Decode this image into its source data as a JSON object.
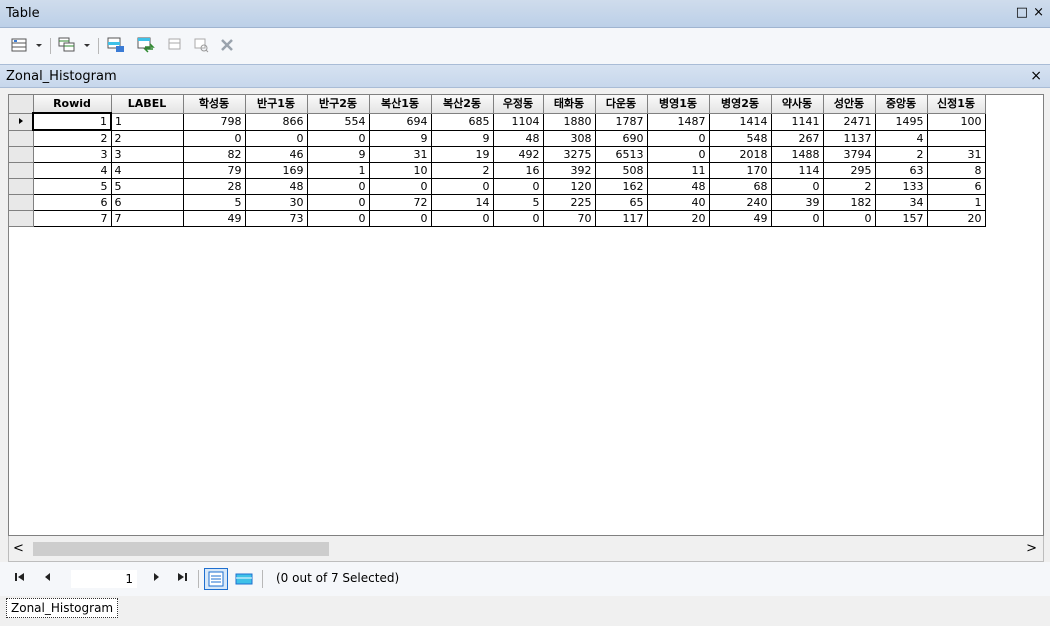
{
  "window": {
    "title": "Table",
    "restore_glyph": "□",
    "close_glyph": "×"
  },
  "toolbar": {
    "icons": [
      "table-options-icon",
      "dropdown-arrow-icon",
      "related-tables-icon",
      "dropdown-arrow-icon",
      "select-by-attributes-icon",
      "switch-selection-icon",
      "clear-selection-icon",
      "zoom-to-selected-icon",
      "delete-selected-icon"
    ]
  },
  "tab": {
    "title": "Zonal_Histogram",
    "close_glyph": "×"
  },
  "table": {
    "columns": [
      "Rowid",
      "LABEL",
      "학성동",
      "반구1동",
      "반구2동",
      "복산1동",
      "복산2동",
      "우정동",
      "태화동",
      "다운동",
      "병영1동",
      "병영2동",
      "약사동",
      "성안동",
      "중앙동",
      "신정1동"
    ],
    "column_widths": [
      78,
      72,
      62,
      62,
      62,
      62,
      62,
      50,
      52,
      52,
      62,
      62,
      52,
      52,
      52,
      58
    ],
    "rows": [
      [
        "1",
        "1",
        "798",
        "866",
        "554",
        "694",
        "685",
        "1104",
        "1880",
        "1787",
        "1487",
        "1414",
        "1141",
        "2471",
        "1495",
        "100"
      ],
      [
        "2",
        "2",
        "0",
        "0",
        "0",
        "9",
        "9",
        "48",
        "308",
        "690",
        "0",
        "548",
        "267",
        "1137",
        "4",
        ""
      ],
      [
        "3",
        "3",
        "82",
        "46",
        "9",
        "31",
        "19",
        "492",
        "3275",
        "6513",
        "0",
        "2018",
        "1488",
        "3794",
        "2",
        "31"
      ],
      [
        "4",
        "4",
        "79",
        "169",
        "1",
        "10",
        "2",
        "16",
        "392",
        "508",
        "11",
        "170",
        "114",
        "295",
        "63",
        "8"
      ],
      [
        "5",
        "5",
        "28",
        "48",
        "0",
        "0",
        "0",
        "0",
        "120",
        "162",
        "48",
        "68",
        "0",
        "2",
        "133",
        "6"
      ],
      [
        "6",
        "6",
        "5",
        "30",
        "0",
        "72",
        "14",
        "5",
        "225",
        "65",
        "40",
        "240",
        "39",
        "182",
        "34",
        "1"
      ],
      [
        "7",
        "7",
        "49",
        "73",
        "0",
        "0",
        "0",
        "0",
        "70",
        "117",
        "20",
        "49",
        "0",
        "0",
        "157",
        "20"
      ]
    ]
  },
  "scrollbar": {
    "left_glyph": "<",
    "right_glyph": ">"
  },
  "navigation": {
    "first_glyph": "⏮",
    "prev_glyph": "◀",
    "next_glyph": "▶",
    "last_glyph": "⏭",
    "current_record": "1",
    "selection_status": "(0 out of 7 Selected)"
  },
  "bottom_tab": {
    "label": "Zonal_Histogram"
  },
  "colors": {
    "accent": "#1e6fd0",
    "titlebar": "#c3d5ea"
  }
}
